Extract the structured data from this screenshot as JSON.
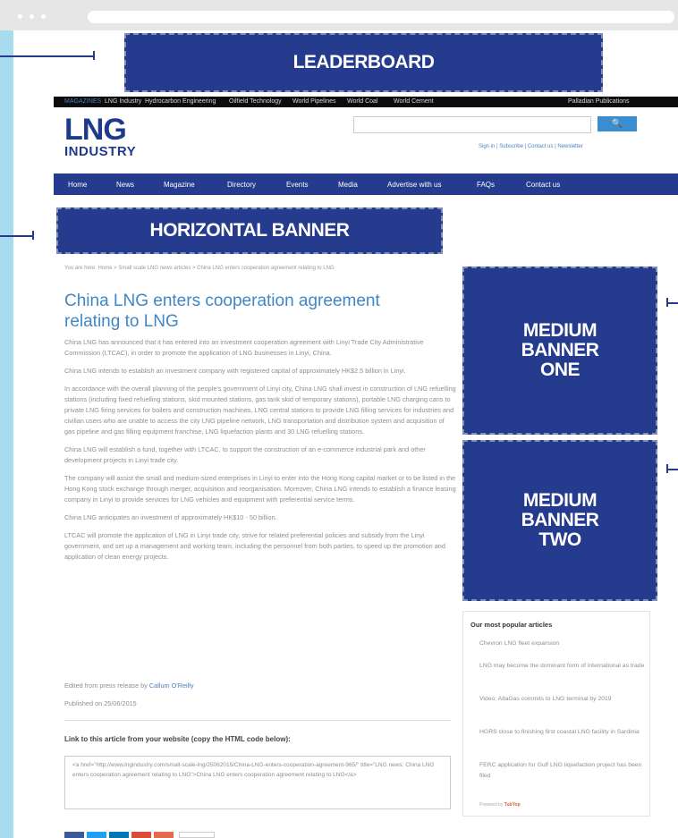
{
  "browser": {
    "address": ""
  },
  "ads": {
    "leaderboard": "LEADERBOARD",
    "horizontal": "HORIZONTAL BANNER",
    "medium_one": [
      "MEDIUM",
      "BANNER",
      "ONE"
    ],
    "medium_two": [
      "MEDIUM",
      "BANNER",
      "TWO"
    ]
  },
  "topnav": {
    "items": [
      "MAGAZINES",
      "LNG Industry",
      "Hydrocarbon Engineering",
      "Oilfield Technology",
      "World Pipelines",
      "World Coal",
      "World Cement"
    ],
    "right": "Palladian Publications"
  },
  "logo": {
    "line1": "LNG",
    "line2": "INDUSTRY"
  },
  "search": {
    "placeholder": "",
    "button": "🔍"
  },
  "util_links": "Sign in | Subscribe | Contact us | Newsletter",
  "mainnav": [
    "Home",
    "News",
    "Magazine",
    "Directory",
    "Events",
    "Media",
    "Advertise with us",
    "FAQs",
    "Contact us"
  ],
  "breadcrumb": "You are here: Home > Small scale LNG news articles > China LNG enters cooperation agreement relating to LNG",
  "article": {
    "title": "China LNG enters cooperation agreement relating to LNG",
    "paragraphs": [
      "China LNG has announced that it has entered into an investment cooperation agreement with Linyi Trade City Administrative Commission (LTCAC), in order to promote the application of LNG businesses in Linyi, China.",
      "China LNG intends to establish an investment company with registered capital of approximately HK$2.5 billion in Linyi.",
      "In accordance with the overall planning of the people's government of Linyi city, China LNG shall invest in construction of LNG refuelling stations (including fixed refuelling stations, skid mounted stations, gas tank skid of temporary stations), portable LNG charging cans to private LNG firing services for boilers and construction machines, LNG central stations to provide LNG filling services for industries and civilian users who are unable to access the city LNG pipeline network, LNG transportation and distribution system and acquisition of gas pipeline and gas filling equipment franchise, LNG liquefaction plants and 30 LNG refuelling stations.",
      "China LNG will establish a fund, together with LTCAC, to support the construction of an e-commerce industrial park and other development projects in Linyi trade city.",
      "The company will assist the small and medium-sized enterprises in Linyi to enter into the Hong Kong capital market or to be listed in the Hong Kong stock exchange through merger, acquisition and reorganisation. Moreover, China LNG intends to establish a finance leasing company in Linyi to provide services for LNG vehicles and equipment with preferential service terms.",
      "China LNG anticipates an investment of approximately HK$10 - 50 billion.",
      "LTCAC will promote the application of LNG in Linyi trade city, strive for related preferential policies and subsidy from the Linyi government, and set up a management and working team, including the personnel from both parties, to speed up the promotion and application of clean energy projects."
    ],
    "byline_prefix": "Edited from press release by",
    "byline_author": "Callum O'Reilly",
    "published": "Published on 25/06/2015"
  },
  "link_section": {
    "heading": "Link to this article from your website (copy the HTML code below):",
    "code": "<a href=\"http://www.lngindustry.com/small-scale-lng/25062015/China-LNG-enters-cooperation-agreement-965/\" title=\"LNG news: China LNG enters cooperation agreement relating to LNG\">China LNG enters cooperation agreement relating to LNG</a>"
  },
  "popular": {
    "heading": "Our most popular articles",
    "items": [
      "Chevron LNG fleet expansion",
      "LNG may become the dominant form of international as trade",
      "Video: AltaGas commits to LNG terminal by 2019",
      "HGRS close to finishing first coastal LNG facility in Sardinia",
      "FERC application for Gulf LNG liquefaction project has been filed"
    ],
    "powered": "Powered by",
    "powered_brand": "TubYop"
  },
  "colors": {
    "brand_blue": "#253b8d",
    "link_blue": "#3f87c5",
    "background": "#a7dcef"
  },
  "icons": {
    "search": "search-icon"
  }
}
